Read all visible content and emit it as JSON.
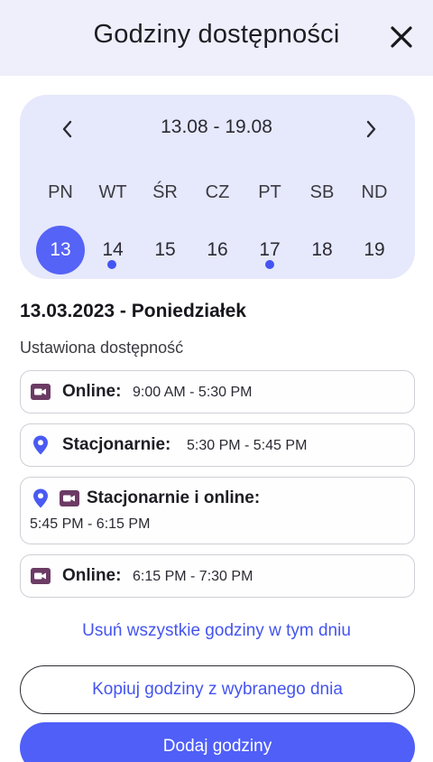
{
  "header": {
    "title": "Godziny dostępności",
    "close_icon": "close-icon"
  },
  "calendar": {
    "range": "13.08 - 19.08",
    "prev_icon": "chevron-left-icon",
    "next_icon": "chevron-right-icon",
    "weekdays": [
      "PN",
      "WT",
      "ŚR",
      "CZ",
      "PT",
      "SB",
      "ND"
    ],
    "days": [
      "13",
      "14",
      "15",
      "16",
      "17",
      "18",
      "19"
    ],
    "selected_day": "13",
    "days_with_dots": [
      "14",
      "17"
    ],
    "accent": "#5563f7"
  },
  "date_heading": "13.03.2023 - Poniedziałek",
  "set_label": "Ustawiona dostępność",
  "slots": [
    {
      "kind": "Online:",
      "time": "9:00 AM - 5:30 PM",
      "icons": [
        "video-icon"
      ]
    },
    {
      "kind": "Stacjonarnie:",
      "time": "5:30 PM - 5:45 PM",
      "icons": [
        "location-pin-icon"
      ]
    },
    {
      "kind": "Stacjonarnie i online:",
      "time": "5:45 PM - 6:15 PM",
      "icons": [
        "location-pin-icon",
        "video-icon"
      ]
    },
    {
      "kind": "Online:",
      "time": "6:15 PM - 7:30 PM",
      "icons": [
        "video-icon"
      ]
    }
  ],
  "actions": {
    "delete_all": "Usuń wszystkie godziny w tym dniu",
    "copy": "Kopiuj godziny z wybranego dnia",
    "add": "Dodaj godziny"
  },
  "colors": {
    "header_bg": "#efeffb",
    "calendar_bg": "#e6e8fb",
    "primary": "#4f5ff8",
    "link": "#4454ef",
    "icon": "#6b3b64",
    "pin": "#4a5af2"
  }
}
